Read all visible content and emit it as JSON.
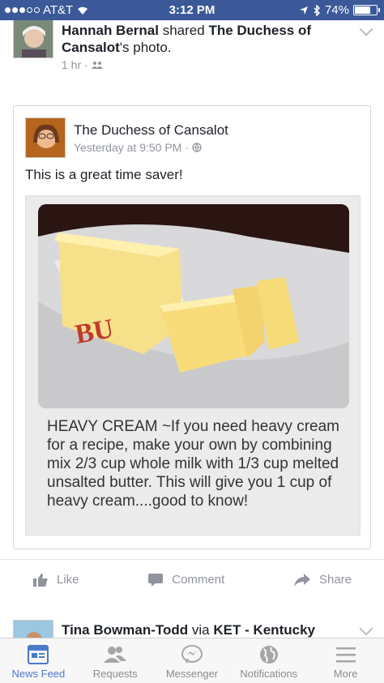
{
  "status_bar": {
    "carrier": "AT&T",
    "time": "3:12 PM",
    "battery": "74%",
    "battery_level": 0.74
  },
  "story1": {
    "sharer_name": "Hannah Bernal",
    "shared_text": "shared",
    "page_name": "The Duchess of Cansalot",
    "photo_suffix": "'s photo.",
    "timestamp": "1 hr",
    "original": {
      "author": "The Duchess of Cansalot",
      "timestamp": "Yesterday at 9:50 PM",
      "caption": "This is a great time saver!",
      "photo_text": "HEAVY CREAM ~If you need heavy cream for a recipe, make your own by combining mix 2/3 cup whole milk with 1/3 cup melted unsalted butter. This will give you 1 cup of heavy cream....good to know!"
    },
    "actions": {
      "like": "Like",
      "comment": "Comment",
      "share": "Share"
    }
  },
  "story2": {
    "author": "Tina Bowman-Todd",
    "via": "via",
    "page": "KET - Kentucky Educational Television"
  },
  "tabs": [
    {
      "label": "News Feed",
      "icon": "news-feed-icon",
      "active": true
    },
    {
      "label": "Requests",
      "icon": "friends-icon",
      "active": false
    },
    {
      "label": "Messenger",
      "icon": "messenger-icon",
      "active": false
    },
    {
      "label": "Notifications",
      "icon": "globe-icon",
      "active": false
    },
    {
      "label": "More",
      "icon": "menu-icon",
      "active": false
    }
  ],
  "colors": {
    "brand": "#3b5998",
    "active_tab": "#4a7ac8"
  }
}
